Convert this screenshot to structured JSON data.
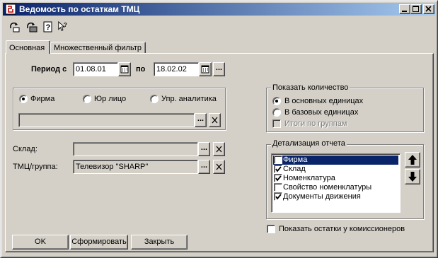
{
  "window": {
    "title": "Ведомость по остаткам ТМЦ"
  },
  "toolbar": {
    "icons": [
      "print-preview-icon",
      "print-icon",
      "help-icon",
      "context-help-icon"
    ]
  },
  "tabs": [
    {
      "label": "Основная",
      "active": true
    },
    {
      "label": "Множественный фильтр",
      "active": false
    }
  ],
  "period": {
    "label": "Период с",
    "from": "01.08.01",
    "to_label": "по",
    "to": "18.02.02",
    "more_button": "..."
  },
  "entity": {
    "options": [
      {
        "label": "Фирма",
        "selected": true
      },
      {
        "label": "Юр лицо",
        "selected": false
      },
      {
        "label": "Упр. аналитика",
        "selected": false
      }
    ],
    "value": "",
    "select_button": "...",
    "clear_button": "X"
  },
  "warehouse": {
    "label": "Склад:",
    "value": "",
    "select_button": "...",
    "clear_button": "X"
  },
  "item_group": {
    "label": "ТМЦ/группа:",
    "value": "Телевизор \"SHARP\"",
    "select_button": "...",
    "clear_button": "X"
  },
  "show_quantity": {
    "title": "Показать количество",
    "options": [
      {
        "label": "В основных единицах",
        "selected": true
      },
      {
        "label": "В базовых единицах",
        "selected": false
      }
    ],
    "group_totals": {
      "label": "Итоги по группам",
      "checked": false,
      "enabled": false
    }
  },
  "detail": {
    "title": "Детализация отчета",
    "items": [
      {
        "label": "Фирма",
        "checked": false,
        "selected": true
      },
      {
        "label": "Склад",
        "checked": true,
        "selected": false
      },
      {
        "label": "Номенклатура",
        "checked": true,
        "selected": false
      },
      {
        "label": "Свойство номенклатуры",
        "checked": false,
        "selected": false
      },
      {
        "label": "Документы движения",
        "checked": true,
        "selected": false
      }
    ]
  },
  "show_commission": {
    "label": "Показать остатки у комиссионеров",
    "checked": false
  },
  "buttons": {
    "ok": "OK",
    "generate": "Сформировать",
    "close": "Закрыть"
  }
}
